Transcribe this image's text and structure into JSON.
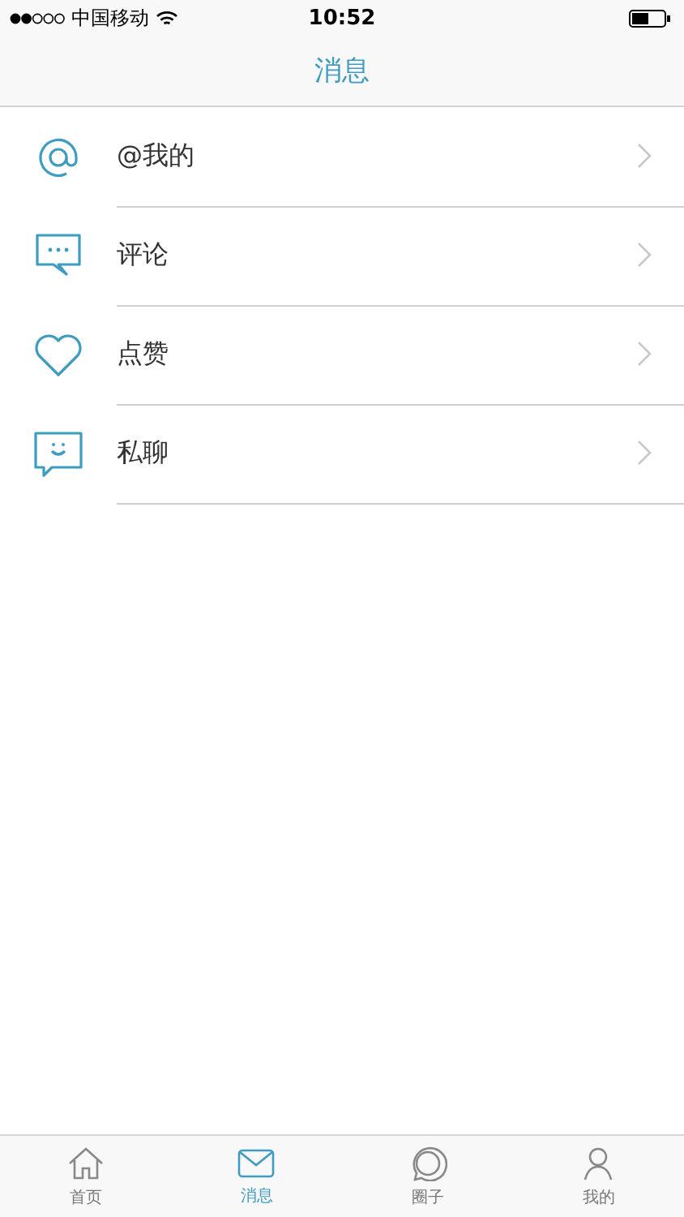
{
  "status_bar": {
    "carrier": "中国移动",
    "time": "10:52"
  },
  "nav": {
    "title": "消息"
  },
  "items": [
    {
      "kind": "mention",
      "label": "@我的"
    },
    {
      "kind": "comment",
      "label": "评论"
    },
    {
      "kind": "like",
      "label": "点赞"
    },
    {
      "kind": "chat",
      "label": "私聊"
    }
  ],
  "tabs": [
    {
      "kind": "home",
      "label": "首页",
      "selected": false
    },
    {
      "kind": "messages",
      "label": "消息",
      "selected": true
    },
    {
      "kind": "circle",
      "label": "圈子",
      "selected": false
    },
    {
      "kind": "profile",
      "label": "我的",
      "selected": false
    }
  ]
}
